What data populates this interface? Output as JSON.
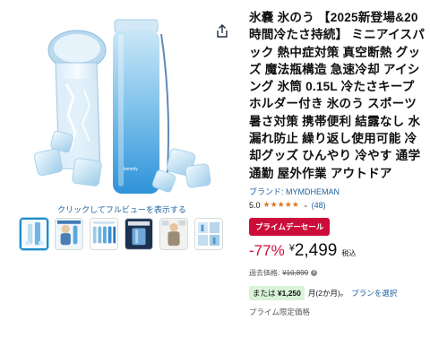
{
  "product": {
    "title": "氷嚢 氷のう 【2025新登場&20時間冷たさ持続】 ミニアイスパック 熱中症対策 真空断熱 グッズ 魔法瓶構造 急速冷却 アイシング 氷筒 0.15L 冷たさキープホルダー付き 氷のう スポーツ 暑さ対策 携帯便利 結露なし 水漏れ防止 繰り返し使用可能 冷却グッズ ひんやり 冷やす 通学通勤 屋外作業 アウトドア",
    "brand_label": "ブランド: MYMDHEMAN",
    "rating": "5.0",
    "review_count": "(48)",
    "bottle_brand": "kemnly"
  },
  "gallery": {
    "zoom_hint": "クリックしてフルビューを表示する",
    "thumbnails": [
      "thumb-1",
      "thumb-2",
      "thumb-3",
      "thumb-4",
      "thumb-5",
      "thumb-6"
    ]
  },
  "deal": {
    "badge": "プライムデーセール",
    "discount": "-77%",
    "currency": "¥",
    "price": "2,499",
    "tax_label": "税込",
    "past_label": "過去価格:",
    "past_price": "¥10,899"
  },
  "installment": {
    "prefix": "または",
    "amount": "¥1,250",
    "term": "月(2か月)。",
    "plan_link": "プランを選択"
  },
  "prime_only": "プライム限定価格",
  "colors": {
    "deal_red": "#cc0c39",
    "link_blue": "#2162a1",
    "star_orange": "#de7921",
    "installment_green": "#d8f3d8"
  }
}
